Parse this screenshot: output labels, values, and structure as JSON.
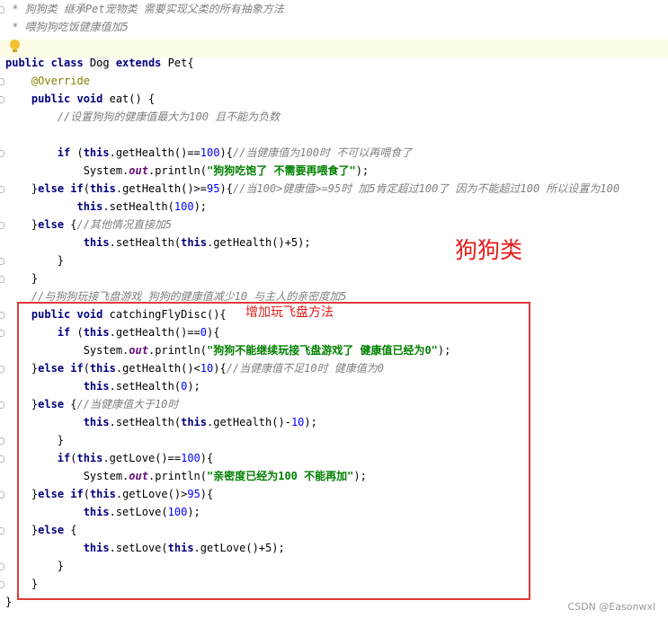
{
  "code": {
    "doc1": " * 狗狗类 继承Pet宠物类 需要实现父类的所有抽象方法",
    "doc2": " * 喂狗狗吃饭健康值加5",
    "class_kw": "public class ",
    "class_name": "Dog",
    "extends_kw": " extends ",
    "parent": "Pet{",
    "override": "@Override",
    "eat_kw": "public void ",
    "eat_sig": "eat() {",
    "eat_cm": "//设置狗狗的健康值最大为100 且不能为负数",
    "if1_kw": "if",
    "if1_a": " (",
    "this": "this",
    "if1_b": ".getHealth()==",
    "n100": "100",
    "if1_c": "){",
    "if1_cm": "//当健康值为100时 不可以再喂食了",
    "sys": "System.",
    "out": "out",
    "println": ".println(",
    "str1": "\"狗狗吃饱了 不需要再喂食了\"",
    "close_paren": ");",
    "else_brace": "}",
    "else_if": "else if",
    "paren_open": "(",
    "gh_ge": ".getHealth()>=",
    "n95": "95",
    "brace_open": "){",
    "cm_95": "//当100>健康值>=95时 加5肯定超过100了 因为不能超过100 所以设置为100",
    "set_health": ".setHealth(",
    "set_end": ");",
    "else_kw": "else",
    "else_open": " {",
    "cm_other": "//其他情况直接加5",
    "plus5": "+5",
    "gh_call": ".getHealth()",
    "close_brace": "}",
    "cm_fly": "//与狗狗玩接飞盘游戏 狗狗的健康值减少10 与主人的亲密度加5",
    "fly_sig": "catchingFlyDisc(){",
    "gh_eq": ".getHealth()==",
    "n0": "0",
    "str2": "\"狗狗不能继续玩接飞盘游戏了 健康值已经为0\"",
    "gh_lt": ".getHealth()<",
    "n10": "10",
    "cm_lt10": "//当健康值不足10时 健康值为0",
    "cm_gt10": "//当健康值大于10时",
    "minus10": "-",
    "gl_eq": ".getLove()==",
    "str3": "\"亲密度已经为100 不能再加\"",
    "gl_gt": ".getLove()>",
    "set_love": ".setLove(",
    "gl_call": ".getLove()"
  },
  "annotations": {
    "dog_class_label": "狗狗类",
    "new_method_label": "增加玩飞盘方法"
  },
  "watermark": "CSDN @Easonwxl",
  "colors": {
    "keyword": "#000080",
    "comment": "#808080",
    "number": "#0000ff",
    "string": "#008000",
    "annotation": "#808000",
    "static_field": "#660e7a",
    "highlight_box": "#e03a3a"
  },
  "icons": [
    "intention-bulb-icon",
    "fold-marker-icon"
  ]
}
